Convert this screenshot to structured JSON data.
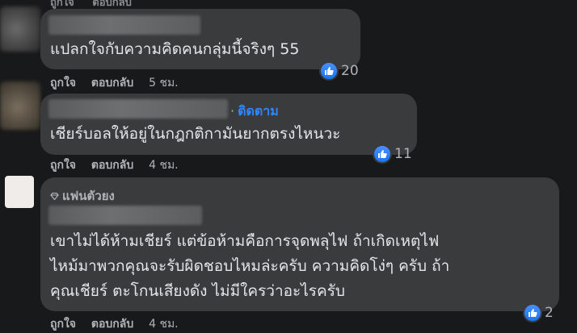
{
  "top": {
    "like": "ถูกใจ",
    "reply": "ตอบกลับ"
  },
  "comments": [
    {
      "text_lines": [
        "แปลกใจกับความคิดคนกลุ่มนี้จริงๆ 55"
      ],
      "reaction_count": "20",
      "actions": {
        "like": "ถูกใจ",
        "reply": "ตอบกลับ",
        "time": "5 ชม."
      }
    },
    {
      "follow_label": "ติดตาม",
      "text_lines": [
        "เชียร์บอลให้อยู่ในกฎกติกามันยากตรงไหนวะ"
      ],
      "reaction_count": "11",
      "actions": {
        "like": "ถูกใจ",
        "reply": "ตอบกลับ",
        "time": "4 ชม."
      }
    },
    {
      "badge": "แฟนตัวยง",
      "text_lines": [
        "เขาไม่ได้ห้ามเชียร์ แต่ข้อห้ามคือการจุดพลุไฟ ถ้าเกิดเหตุไฟ",
        "ไหม้มาพวกคุณจะรับผิดชอบไหมล่ะครับ ความคิดโง่ๆ ครับ ถ้า",
        "คุณเชียร์ ตะโกนเสียงดัง ไม่มีใครว่าอะไรครับ"
      ],
      "reaction_count": "2",
      "actions": {
        "like": "ถูกใจ",
        "reply": "ตอบกลับ",
        "time": "4 ชม."
      }
    }
  ]
}
